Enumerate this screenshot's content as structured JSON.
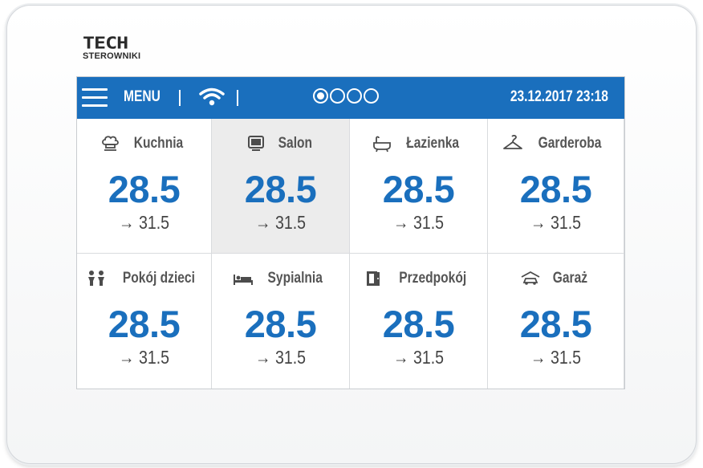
{
  "logo": {
    "top": "TECH",
    "bottom": "STEROWNIKI"
  },
  "topbar": {
    "menu_label": "MENU",
    "wifi_icon": "wifi-icon",
    "pages": {
      "total": 4,
      "active": 1
    },
    "datetime": "23.12.2017 23:18",
    "accent_color": "#1a6fbd"
  },
  "rooms": [
    {
      "name": "Kuchnia",
      "icon": "chef-hat-icon",
      "temp": "28.5",
      "target": "→ 31.5"
    },
    {
      "name": "Salon",
      "icon": "tv-icon",
      "temp": "28.5",
      "target": "→ 31.5",
      "selected": true
    },
    {
      "name": "Łazienka",
      "icon": "bathtub-icon",
      "temp": "28.5",
      "target": "→ 31.5"
    },
    {
      "name": "Garderoba",
      "icon": "hanger-icon",
      "temp": "28.5",
      "target": "→ 31.5"
    },
    {
      "name": "Pokój dzieci",
      "icon": "children-icon",
      "temp": "28.5",
      "target": "→ 31.5"
    },
    {
      "name": "Sypialnia",
      "icon": "bed-icon",
      "temp": "28.5",
      "target": "→ 31.5"
    },
    {
      "name": "Przedpokój",
      "icon": "door-icon",
      "temp": "28.5",
      "target": "→ 31.5"
    },
    {
      "name": "Garaż",
      "icon": "car-garage-icon",
      "temp": "28.5",
      "target": "→ 31.5"
    }
  ]
}
